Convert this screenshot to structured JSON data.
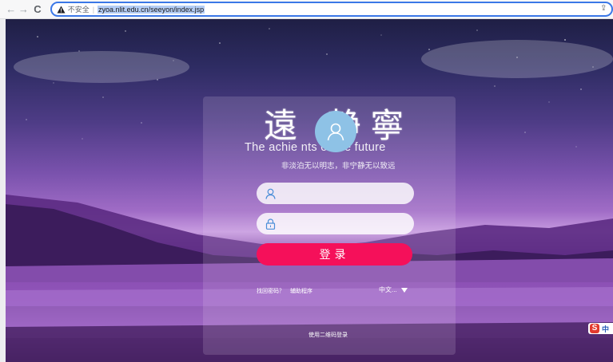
{
  "browser": {
    "back": "←",
    "forward": "→",
    "reload": "C",
    "insecure_label": "不安全",
    "separator": "|",
    "url": "zyoa.nlit.edu.cn/seeyon/index.jsp",
    "share": "⇪"
  },
  "login": {
    "calligraphy": "遠 静寧",
    "tagline_en": "The achie         nts of the future",
    "tagline_cn": "非淡泊无以明志，非宁静无以致远",
    "username_placeholder": "",
    "password_placeholder": "",
    "submit_label": "登录",
    "forgot_password": "找回密码？",
    "assist_program": "辅助程序",
    "language": "中文...",
    "qr_login": "使用二维码登录"
  },
  "ime": {
    "logo": "S",
    "label": "中"
  },
  "colors": {
    "accent": "#f5105a",
    "avatar": "#8ec2e6",
    "url_border": "#3b78e7"
  },
  "icons": [
    "warning-icon",
    "share-icon",
    "avatar-icon",
    "user-icon",
    "lock-icon",
    "dropdown-arrow-icon"
  ]
}
